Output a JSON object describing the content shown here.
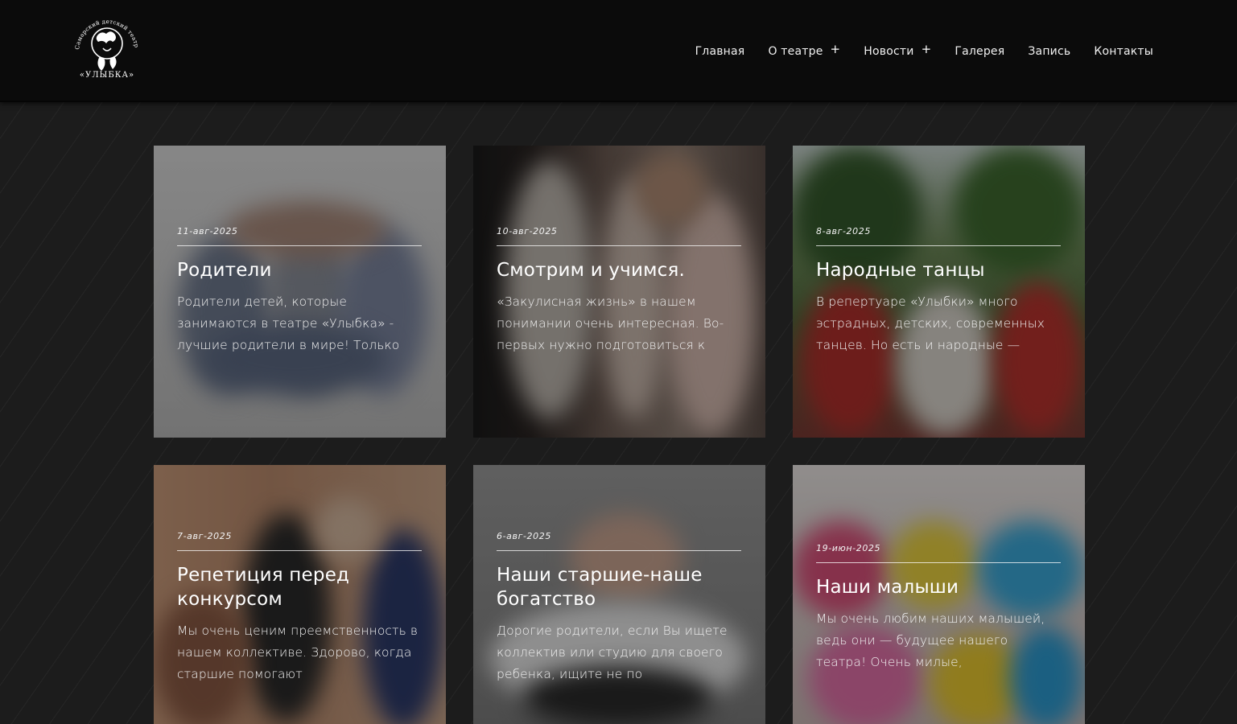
{
  "site": {
    "logo_label": "Самарский детский театр танца «УЛЫБКА»"
  },
  "nav": {
    "items": [
      {
        "label": "Главная",
        "has_submenu": false
      },
      {
        "label": "О театре",
        "has_submenu": true
      },
      {
        "label": "Новости",
        "has_submenu": true
      },
      {
        "label": "Галерея",
        "has_submenu": false
      },
      {
        "label": "Запись",
        "has_submenu": false
      },
      {
        "label": "Контакты",
        "has_submenu": false
      }
    ],
    "submenu_glyph": "+"
  },
  "posts": [
    {
      "date": "11-авг-2025",
      "title": "Родители",
      "excerpt": "Родители детей, которые занимаются в театре «Улыбка» - лучшие родители в мире! Только"
    },
    {
      "date": "10-авг-2025",
      "title": "Смотрим и учимся.",
      "excerpt": "«Закулисная жизнь» в нашем понимании очень интересная. Во-первых нужно подготовиться к"
    },
    {
      "date": "8-авг-2025",
      "title": "Народные танцы",
      "excerpt": "В репертуаре «Улыбки» много эстрадных, детских, современных танцев. Но есть и народные —"
    },
    {
      "date": "7-авг-2025",
      "title": "Репетиция перед конкурсом",
      "excerpt": "Мы очень ценим преемственность в нашем коллективе. Здорово, когда старшие помогают"
    },
    {
      "date": "6-авг-2025",
      "title": "Наши старшие-наше богатство",
      "excerpt": "Дорогие родители, если Вы ищете коллектив или студию для своего ребенка, ищите не по"
    },
    {
      "date": "19-июн-2025",
      "title": "Наши малыши",
      "excerpt": "Мы очень любим наших малышей, ведь они — будущее нашего театра! Очень милые,"
    }
  ],
  "colors": {
    "header_bg": "#0b0b0b",
    "page_bg": "#1c1c1c",
    "text": "#ffffff"
  }
}
